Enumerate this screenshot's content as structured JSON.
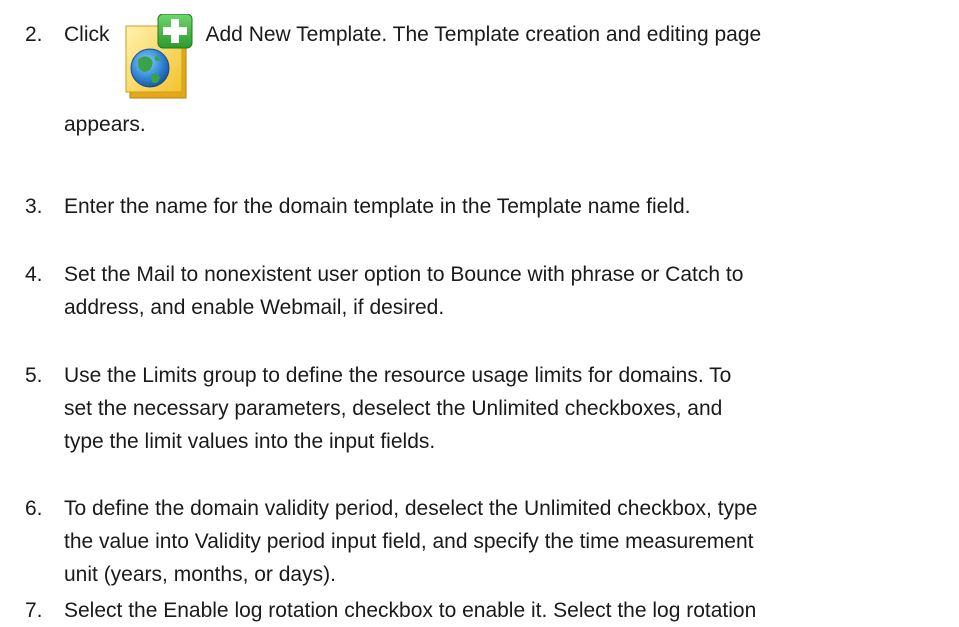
{
  "steps": [
    {
      "number": "2.",
      "text_before_icon": "Click",
      "icon": "add-new-template-icon",
      "text_after_icon": "Add New Template. The Template creation and editing page",
      "continuation": "appears."
    },
    {
      "number": "3.",
      "lines": [
        "Enter the name for the domain template in the Template name field."
      ]
    },
    {
      "number": "4.",
      "lines": [
        "Set the Mail to nonexistent user option to Bounce with phrase or Catch to",
        "address, and enable Webmail, if desired."
      ]
    },
    {
      "number": "5.",
      "lines": [
        "Use the Limits group to define the resource usage limits for domains. To",
        "set the necessary parameters, deselect the Unlimited checkboxes, and",
        "type the limit values into the input fields."
      ]
    },
    {
      "number": "6.",
      "lines": [
        "To define the domain validity period, deselect the Unlimited checkbox, type",
        "the value into Validity period input field, and specify the time measurement",
        "unit (years, months, or days)."
      ]
    },
    {
      "number": "7.",
      "lines": [
        "Select the Enable log rotation checkbox to enable it. Select the log rotation"
      ]
    }
  ]
}
